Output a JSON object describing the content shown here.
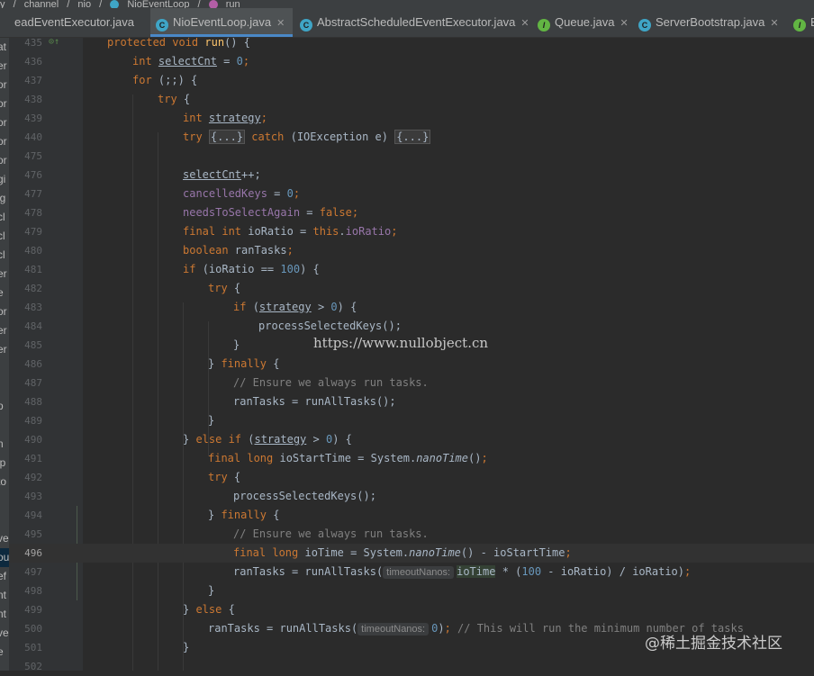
{
  "breadcrumb": [
    "y",
    "channel",
    "nio",
    "NioEventLoop",
    "run"
  ],
  "tabs": [
    {
      "label": "eadEventExecutor.java",
      "icon": "none",
      "active": false
    },
    {
      "label": "NioEventLoop.java",
      "icon": "class",
      "active": true
    },
    {
      "label": "AbstractScheduledEventExecutor.java",
      "icon": "class",
      "active": false
    },
    {
      "label": "Queue.java",
      "icon": "interface",
      "active": false
    },
    {
      "label": "ServerBootstrap.java",
      "icon": "class",
      "active": false
    },
    {
      "label": "E",
      "icon": "interface",
      "active": false
    }
  ],
  "project_tree": [
    "at",
    "er",
    "or",
    "or",
    "or",
    "or",
    "or",
    "gi",
    "lg",
    "cl",
    "cl",
    "cl",
    "er",
    "e",
    "or",
    "er",
    "er",
    "",
    "",
    "p",
    "",
    "n",
    "ip",
    "to",
    "",
    "",
    "ve",
    "ou",
    "ef",
    "nt",
    "nt",
    "ve",
    "e"
  ],
  "lines": {
    "l435": {
      "num": "435",
      "t1": "protected void ",
      "t2": "run",
      "t3": "() {"
    },
    "l436": {
      "num": "436",
      "t1": "int ",
      "t2": "selectCnt",
      "t3": " = ",
      "t4": "0",
      "t5": ";"
    },
    "l437": {
      "num": "437",
      "t1": "for ",
      "t2": "(;;) {"
    },
    "l438": {
      "num": "438",
      "t1": "try ",
      "t2": "{"
    },
    "l439": {
      "num": "439",
      "t1": "int ",
      "t2": "strategy",
      "t3": ";"
    },
    "l440": {
      "num": "440",
      "t1": "try ",
      "t2": "{...}",
      "t3": " catch ",
      "t4": "(IOException e) ",
      "t5": "{...}"
    },
    "l475": {
      "num": "475"
    },
    "l476": {
      "num": "476",
      "t1": "selectCnt",
      "t2": "++;"
    },
    "l477": {
      "num": "477",
      "t1": "cancelledKeys",
      "t2": " = ",
      "t3": "0",
      "t4": ";"
    },
    "l478": {
      "num": "478",
      "t1": "needsToSelectAgain",
      "t2": " = ",
      "t3": "false",
      "t4": ";"
    },
    "l479": {
      "num": "479",
      "t1": "final int ",
      "t2": "ioRatio = ",
      "t3": "this",
      "t4": ".",
      "t5": "ioRatio",
      "t6": ";"
    },
    "l480": {
      "num": "480",
      "t1": "boolean ",
      "t2": "ranTasks",
      "t3": ";"
    },
    "l481": {
      "num": "481",
      "t1": "if ",
      "t2": "(ioRatio == ",
      "t3": "100",
      "t4": ") {"
    },
    "l482": {
      "num": "482",
      "t1": "try ",
      "t2": "{"
    },
    "l483": {
      "num": "483",
      "t1": "if ",
      "t2": "(",
      "t3": "strategy",
      "t4": " > ",
      "t5": "0",
      "t6": ") {"
    },
    "l484": {
      "num": "484",
      "t1": "processSelectedKeys();"
    },
    "l485": {
      "num": "485",
      "t1": "}"
    },
    "l486": {
      "num": "486",
      "t1": "} ",
      "t2": "finally ",
      "t3": "{"
    },
    "l487": {
      "num": "487",
      "t1": "// Ensure we always run tasks."
    },
    "l488": {
      "num": "488",
      "t1": "ranTasks = runAllTasks();"
    },
    "l489": {
      "num": "489",
      "t1": "}"
    },
    "l490": {
      "num": "490",
      "t1": "} ",
      "t2": "else if ",
      "t3": "(",
      "t4": "strategy",
      "t5": " > ",
      "t6": "0",
      "t7": ") {"
    },
    "l491": {
      "num": "491",
      "t1": "final long ",
      "t2": "ioStartTime = System.",
      "t3": "nanoTime",
      "t4": "()",
      "t5": ";"
    },
    "l492": {
      "num": "492",
      "t1": "try ",
      "t2": "{"
    },
    "l493": {
      "num": "493",
      "t1": "processSelectedKeys();"
    },
    "l494": {
      "num": "494",
      "t1": "} ",
      "t2": "finally ",
      "t3": "{"
    },
    "l495": {
      "num": "495",
      "t1": "// Ensure we always run tasks."
    },
    "l496": {
      "num": "496",
      "t1": "final long ",
      "t2": "ioTime",
      "t3": " = System.",
      "t4": "nanoTime",
      "t5": "() - ioStartTime",
      "t6": ";"
    },
    "l497": {
      "num": "497",
      "t1": "ranTasks = runAllTasks(",
      "hint": "timeoutNanos:",
      "t2": "ioTime",
      "t3": " * (",
      "t4": "100",
      "t5": " - ioRatio) / ioRatio)",
      "t6": ";"
    },
    "l498": {
      "num": "498",
      "t1": "}"
    },
    "l499": {
      "num": "499",
      "t1": "} ",
      "t2": "else ",
      "t3": "{"
    },
    "l500": {
      "num": "500",
      "t1": "ranTasks = runAllTasks(",
      "hint": "timeoutNanos:",
      "t2": "0",
      "t3": ")",
      "t4": "; ",
      "t5": "// This will run the minimum number of tasks"
    },
    "l501": {
      "num": "501",
      "t1": "}"
    },
    "l502": {
      "num": "502"
    }
  },
  "watermark": "https://www.nullobject.cn",
  "juejin_watermark": "@稀土掘金技术社区",
  "colors": {
    "keyword": "#cc7832",
    "number": "#6897bb",
    "field": "#9876aa",
    "method": "#ffc66d",
    "comment": "#808080"
  }
}
